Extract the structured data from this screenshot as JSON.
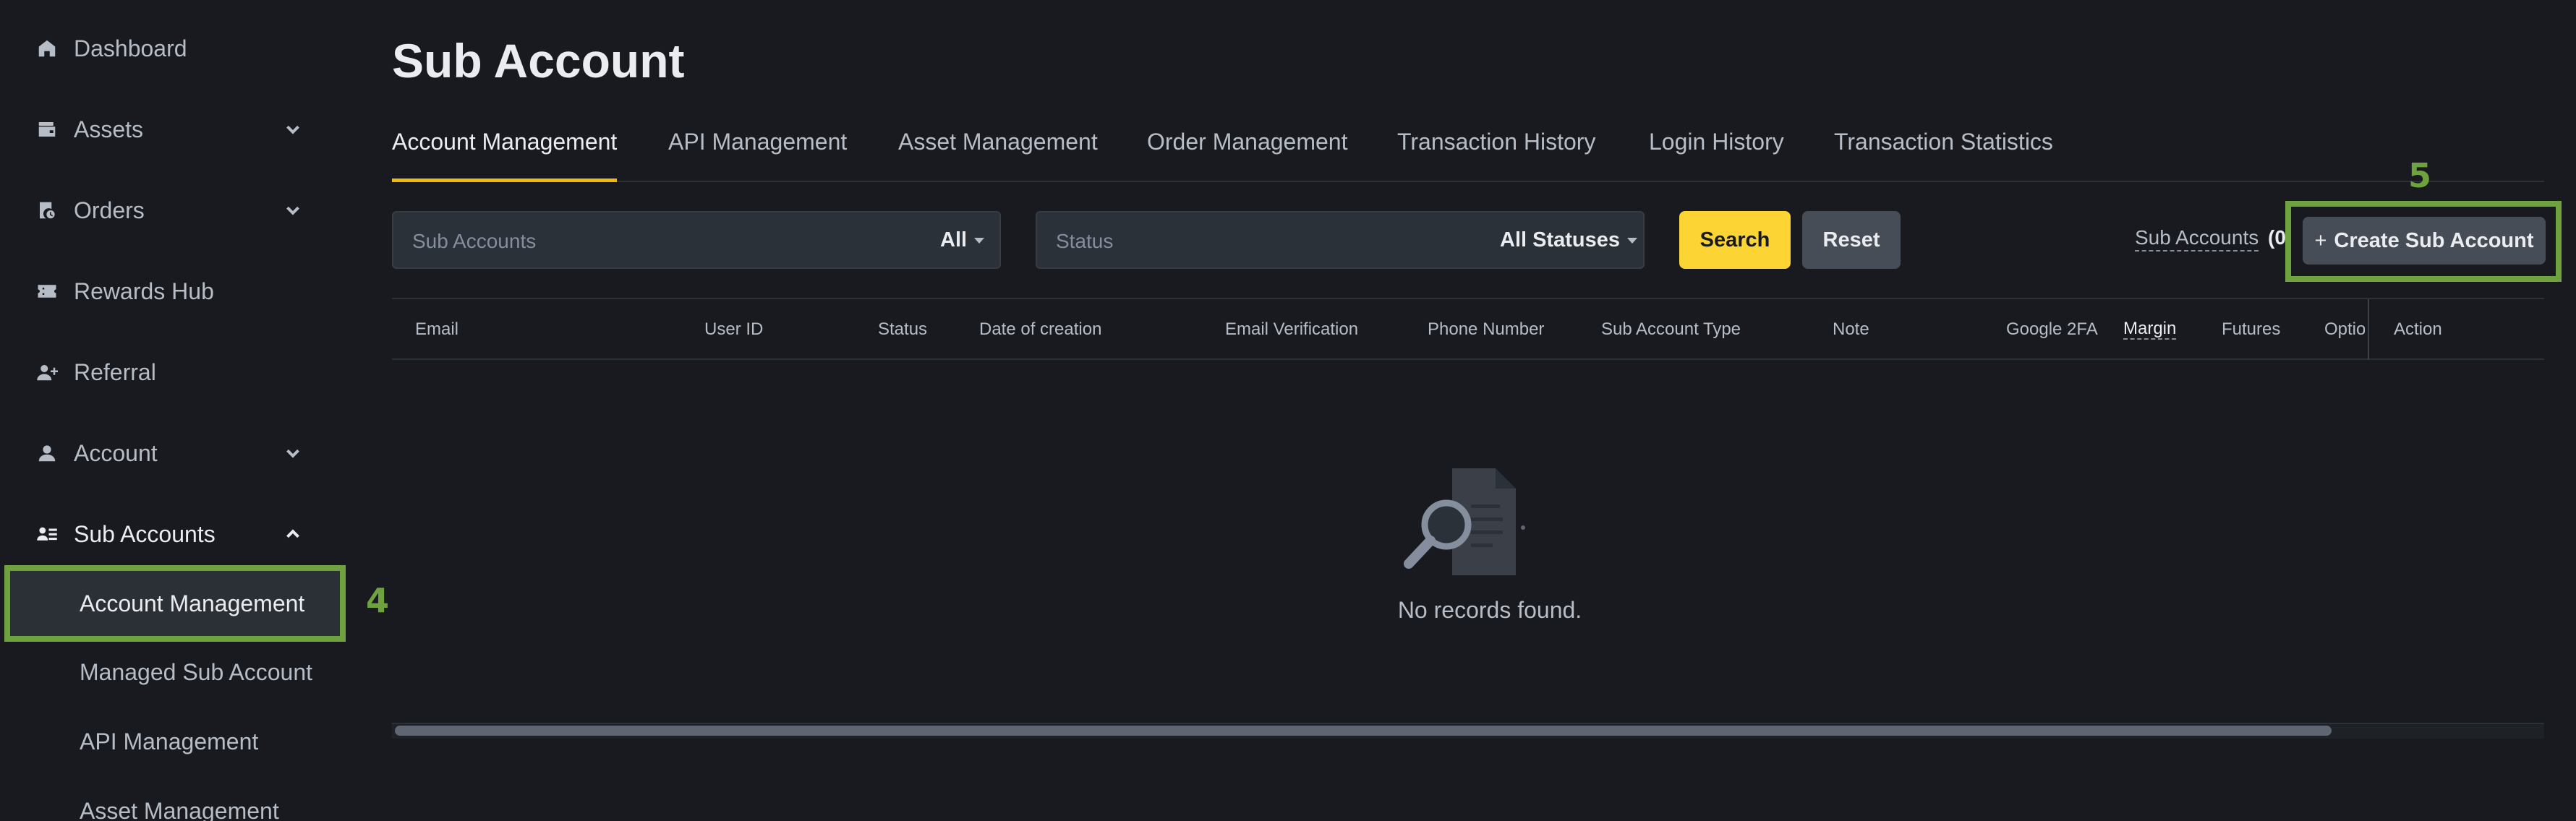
{
  "sidebar": {
    "items": [
      {
        "label": "Dashboard",
        "icon": "home-icon"
      },
      {
        "label": "Assets",
        "icon": "wallet-icon"
      },
      {
        "label": "Orders",
        "icon": "orders-icon"
      },
      {
        "label": "Rewards Hub",
        "icon": "rewards-icon"
      },
      {
        "label": "Referral",
        "icon": "referral-icon"
      },
      {
        "label": "Account",
        "icon": "user-icon"
      },
      {
        "label": "Sub Accounts",
        "icon": "sub-accounts-icon"
      }
    ],
    "sub_items": [
      {
        "label": "Account Management"
      },
      {
        "label": "Managed Sub Account"
      },
      {
        "label": "API Management"
      },
      {
        "label": "Asset Management"
      }
    ],
    "marker": "4"
  },
  "page": {
    "title": "Sub Account"
  },
  "tabs": [
    {
      "label": "Account Management"
    },
    {
      "label": "API Management"
    },
    {
      "label": "Asset Management"
    },
    {
      "label": "Order Management"
    },
    {
      "label": "Transaction History"
    },
    {
      "label": "Login History"
    },
    {
      "label": "Transaction Statistics"
    }
  ],
  "filters": {
    "sub_accounts": {
      "placeholder": "Sub Accounts",
      "selected": "All"
    },
    "status": {
      "placeholder": "Status",
      "selected": "All Statuses"
    },
    "search_label": "Search",
    "reset_label": "Reset"
  },
  "toolbar": {
    "sub_accounts_link": "Sub Accounts",
    "count": "(0",
    "create_plus": "+",
    "create_label": "Create Sub Account",
    "marker": "5"
  },
  "table": {
    "columns": [
      "Email",
      "User ID",
      "Status",
      "Date of creation",
      "Email Verification",
      "Phone Number",
      "Sub Account Type",
      "Note",
      "Google 2FA",
      "Margin",
      "Futures",
      "Options",
      "Action"
    ],
    "empty_text": "No records found."
  },
  "colors": {
    "background": "#181a20",
    "accent": "#f0b90b",
    "search_button": "#fcd535",
    "highlight_box": "#6ea23f"
  }
}
